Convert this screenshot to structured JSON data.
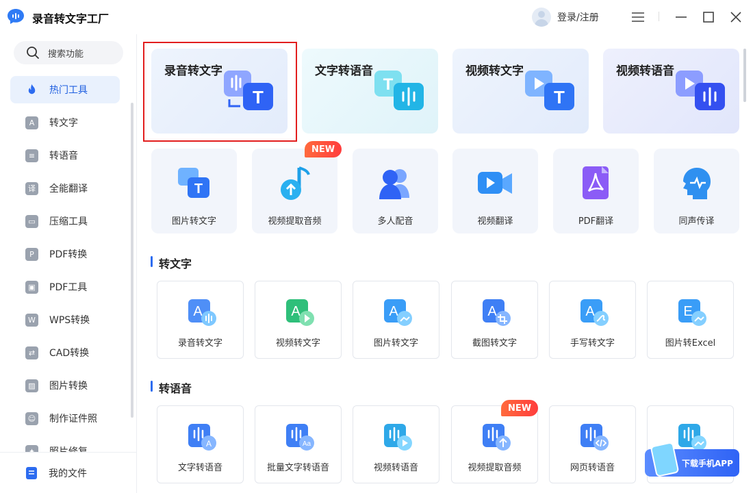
{
  "app": {
    "title": "录音转文字工厂"
  },
  "header": {
    "login": "登录/注册"
  },
  "sidebar": {
    "search_label": "搜索功能",
    "items": [
      {
        "label": "热门工具",
        "icon": "flame-icon"
      },
      {
        "label": "转文字",
        "icon": "text-icon"
      },
      {
        "label": "转语音",
        "icon": "voice-icon"
      },
      {
        "label": "全能翻译",
        "icon": "translate-icon"
      },
      {
        "label": "压缩工具",
        "icon": "compress-icon"
      },
      {
        "label": "PDF转换",
        "icon": "pdf-icon"
      },
      {
        "label": "PDF工具",
        "icon": "toolbox-icon"
      },
      {
        "label": "WPS转换",
        "icon": "wps-icon"
      },
      {
        "label": "CAD转换",
        "icon": "cad-icon"
      },
      {
        "label": "图片转换",
        "icon": "image-icon"
      },
      {
        "label": "制作证件照",
        "icon": "id-photo-icon"
      },
      {
        "label": "照片修复",
        "icon": "photo-repair-icon"
      }
    ],
    "my_files": "我的文件"
  },
  "featured": [
    {
      "label": "录音转文字",
      "icon": "audio-to-text-icon",
      "bg": "#eaf1fd"
    },
    {
      "label": "文字转语音",
      "icon": "text-to-audio-icon",
      "bg": "#e9f8fb"
    },
    {
      "label": "视频转文字",
      "icon": "video-to-text-icon",
      "bg": "#eaf1fd"
    },
    {
      "label": "视频转语音",
      "icon": "video-to-audio-icon",
      "bg": "#eaeffd"
    }
  ],
  "quick": [
    {
      "label": "图片转文字",
      "icon": "image-to-text-icon",
      "badge": ""
    },
    {
      "label": "视频提取音频",
      "icon": "extract-audio-icon",
      "badge": "NEW"
    },
    {
      "label": "多人配音",
      "icon": "multi-voice-icon",
      "badge": ""
    },
    {
      "label": "视频翻译",
      "icon": "video-translate-icon",
      "badge": ""
    },
    {
      "label": "PDF翻译",
      "icon": "pdf-translate-icon",
      "badge": ""
    },
    {
      "label": "同声传译",
      "icon": "interpretation-icon",
      "badge": ""
    }
  ],
  "sections": [
    {
      "title": "转文字",
      "tiles": [
        {
          "label": "录音转文字",
          "icon": "audio-to-text-icon",
          "badge": ""
        },
        {
          "label": "视频转文字",
          "icon": "video-to-text-icon",
          "badge": ""
        },
        {
          "label": "图片转文字",
          "icon": "image-to-text-icon",
          "badge": ""
        },
        {
          "label": "截图转文字",
          "icon": "screenshot-to-text-icon",
          "badge": ""
        },
        {
          "label": "手写转文字",
          "icon": "handwriting-to-text-icon",
          "badge": ""
        },
        {
          "label": "图片转Excel",
          "icon": "image-to-excel-icon",
          "badge": ""
        }
      ]
    },
    {
      "title": "转语音",
      "tiles": [
        {
          "label": "文字转语音",
          "icon": "text-to-audio-icon",
          "badge": ""
        },
        {
          "label": "批量文字转语音",
          "icon": "batch-text-to-audio-icon",
          "badge": ""
        },
        {
          "label": "视频转语音",
          "icon": "video-to-audio-icon",
          "badge": ""
        },
        {
          "label": "视频提取音频",
          "icon": "extract-audio-icon",
          "badge": "NEW"
        },
        {
          "label": "网页转语音",
          "icon": "web-to-audio-icon",
          "badge": ""
        },
        {
          "label": "",
          "icon": "image-to-audio-icon",
          "badge": ""
        }
      ]
    }
  ],
  "download_app": "下载手机APP",
  "colors": {
    "accent": "#2d6cf0",
    "highlight": "#e21d1d",
    "badge": "#ff4a3a"
  }
}
